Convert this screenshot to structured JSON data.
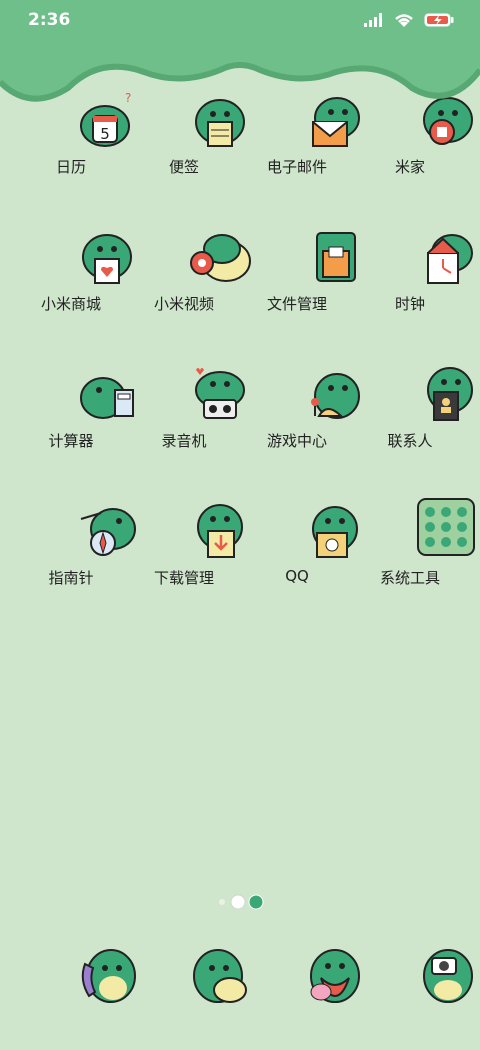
{
  "status": {
    "time": "2:36"
  },
  "colors": {
    "background": "#cfe6cc",
    "scallop": "#6fbf8a",
    "dino": "#3aa776",
    "accent": "#e85b4a"
  },
  "apps": [
    {
      "label": "日历",
      "icon": "calendar-dino-icon"
    },
    {
      "label": "便签",
      "icon": "notes-dino-icon"
    },
    {
      "label": "电子邮件",
      "icon": "email-dino-icon"
    },
    {
      "label": "米家",
      "icon": "mijia-dino-icon"
    },
    {
      "label": "小米商城",
      "icon": "mall-dino-icon"
    },
    {
      "label": "小米视频",
      "icon": "video-dino-icon"
    },
    {
      "label": "文件管理",
      "icon": "files-dino-icon"
    },
    {
      "label": "时钟",
      "icon": "clock-dino-icon"
    },
    {
      "label": "计算器",
      "icon": "calculator-dino-icon"
    },
    {
      "label": "录音机",
      "icon": "recorder-dino-icon"
    },
    {
      "label": "游戏中心",
      "icon": "game-dino-icon"
    },
    {
      "label": "联系人",
      "icon": "contacts-dino-icon"
    },
    {
      "label": "指南针",
      "icon": "compass-dino-icon"
    },
    {
      "label": "下载管理",
      "icon": "download-dino-icon"
    },
    {
      "label": "QQ",
      "icon": "qq-dino-icon"
    },
    {
      "label": "系统工具",
      "icon": "folder-icon"
    }
  ],
  "calendar_day": "5",
  "dock": [
    {
      "icon": "phone-dino-icon"
    },
    {
      "icon": "messages-dino-icon"
    },
    {
      "icon": "browser-dino-icon"
    },
    {
      "icon": "camera-dino-icon"
    }
  ]
}
